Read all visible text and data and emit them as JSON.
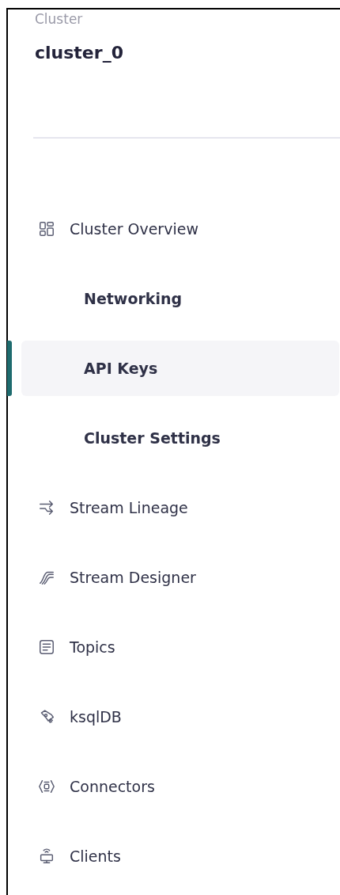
{
  "header": {
    "label": "Cluster",
    "title": "cluster_0"
  },
  "nav": [
    {
      "label": "Cluster Overview",
      "kind": "section",
      "selected": false
    },
    {
      "label": "Networking",
      "kind": "subitem",
      "selected": false
    },
    {
      "label": "API Keys",
      "kind": "subitem",
      "selected": true
    },
    {
      "label": "Cluster Settings",
      "kind": "subitem",
      "selected": false
    },
    {
      "label": "Stream Lineage",
      "kind": "section",
      "selected": false
    },
    {
      "label": "Stream Designer",
      "kind": "section",
      "selected": false
    },
    {
      "label": "Topics",
      "kind": "section",
      "selected": false
    },
    {
      "label": "ksqlDB",
      "kind": "section",
      "selected": false
    },
    {
      "label": "Connectors",
      "kind": "section",
      "selected": false
    },
    {
      "label": "Clients",
      "kind": "section",
      "selected": false
    }
  ]
}
